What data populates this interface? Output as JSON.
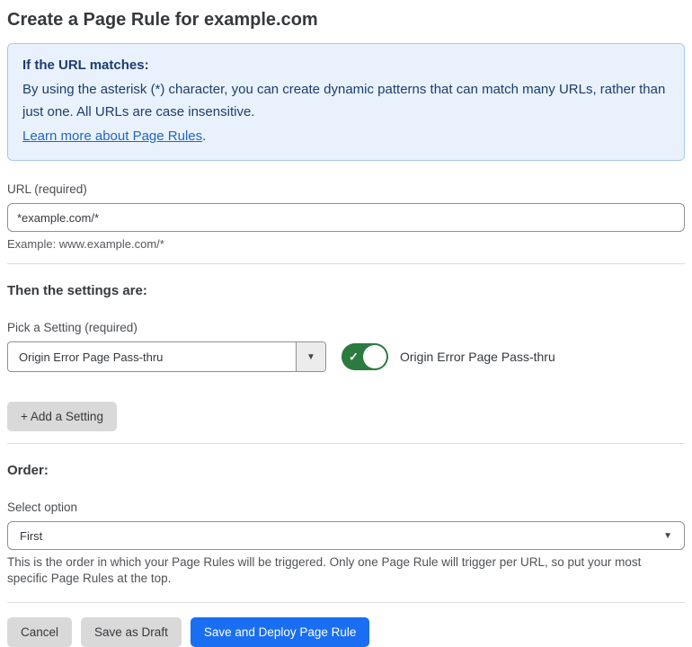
{
  "page": {
    "title": "Create a Page Rule for example.com"
  },
  "info_box": {
    "heading": "If the URL matches:",
    "body": "By using the asterisk (*) character, you can create dynamic patterns that can match many URLs, rather than just one. All URLs are case insensitive.",
    "link_label": "Learn more about Page Rules",
    "link_suffix": "."
  },
  "url_field": {
    "label": "URL (required)",
    "value": "*example.com/*",
    "helper": "Example: www.example.com/*"
  },
  "settings_section": {
    "heading": "Then the settings are:",
    "picker_label": "Pick a Setting (required)",
    "picker_value": "Origin Error Page Pass-thru",
    "picker_arrow": "▼",
    "toggle_state": "on",
    "toggle_check": "✓",
    "toggle_label": "Origin Error Page Pass-thru",
    "add_setting_label": "+ Add a Setting"
  },
  "order_section": {
    "heading": "Order:",
    "select_label": "Select option",
    "select_value": "First",
    "select_arrow": "▼",
    "helper": "This is the order in which your Page Rules will be triggered. Only one Page Rule will trigger per URL, so put your most specific Page Rules at the top."
  },
  "footer": {
    "cancel_label": "Cancel",
    "save_draft_label": "Save as Draft",
    "save_deploy_label": "Save and Deploy Page Rule"
  },
  "colors": {
    "info_bg": "#e9f2fc",
    "info_border": "#aac9ec",
    "info_text": "#1d3c6e",
    "link_blue": "#2265c4",
    "toggle_green": "#2b7a3f",
    "primary_blue": "#1a6ef2",
    "button_gray": "#d9d9d9"
  }
}
